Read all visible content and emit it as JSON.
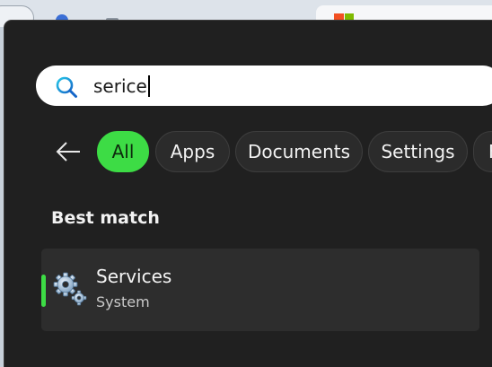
{
  "search": {
    "query": "serice",
    "icon": "search-icon"
  },
  "filters": {
    "back_icon": "arrow-left-icon",
    "chips": [
      {
        "label": "All",
        "active": true
      },
      {
        "label": "Apps",
        "active": false
      },
      {
        "label": "Documents",
        "active": false
      },
      {
        "label": "Settings",
        "active": false
      },
      {
        "label": "F",
        "active": false
      }
    ]
  },
  "results": {
    "section_title": "Best match",
    "best_match": {
      "title": "Services",
      "subtitle": "System",
      "icon": "services-gears-icon"
    }
  },
  "colors": {
    "panel_bg": "#202020",
    "accent": "#3ddc45",
    "row_bg": "#2d2d2d"
  }
}
